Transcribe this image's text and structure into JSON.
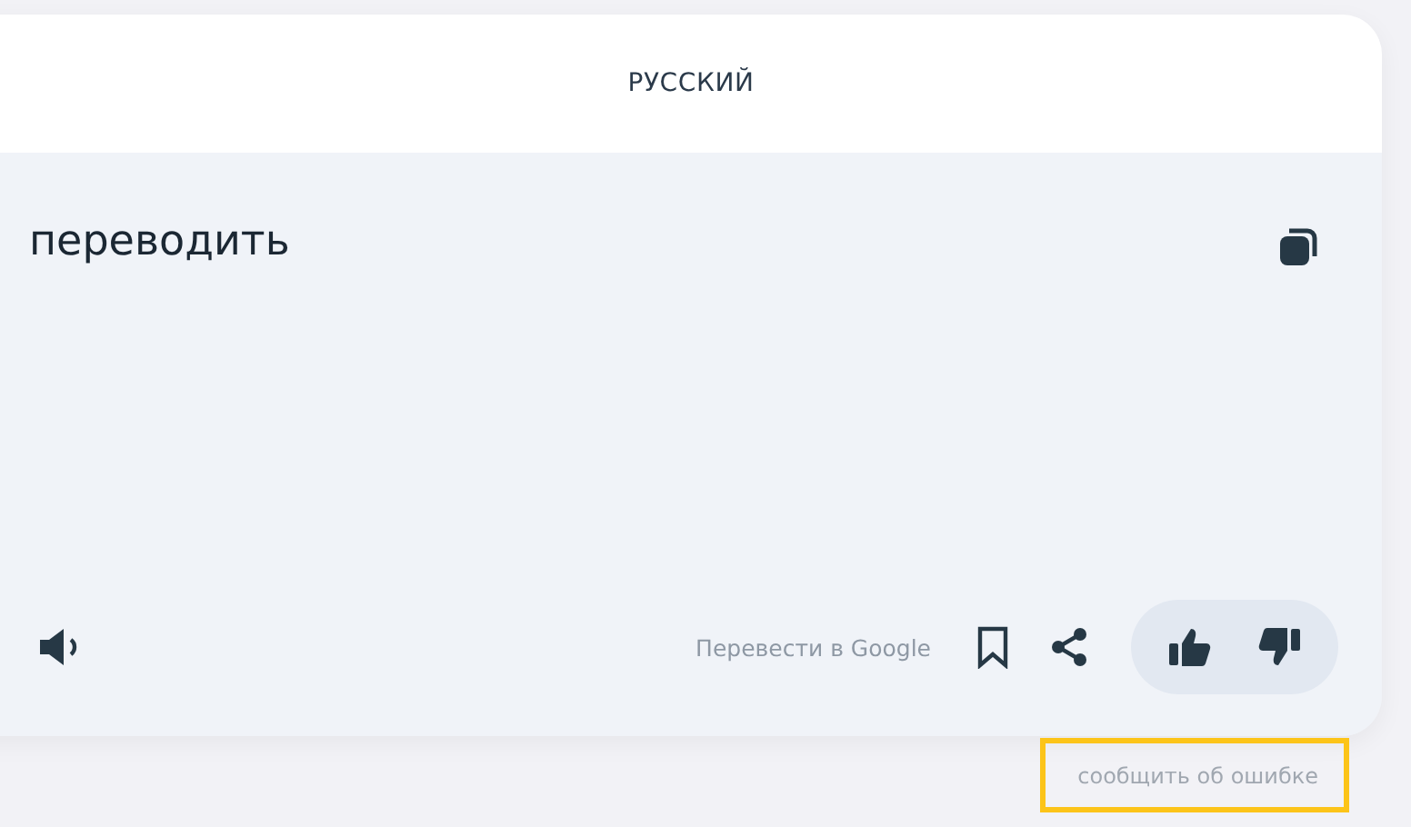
{
  "language": "РУССКИЙ",
  "translation": "переводить",
  "google_link": "Перевести в Google",
  "report_link": {
    "label": "сообщить об ошибке",
    "highlighted": true
  }
}
